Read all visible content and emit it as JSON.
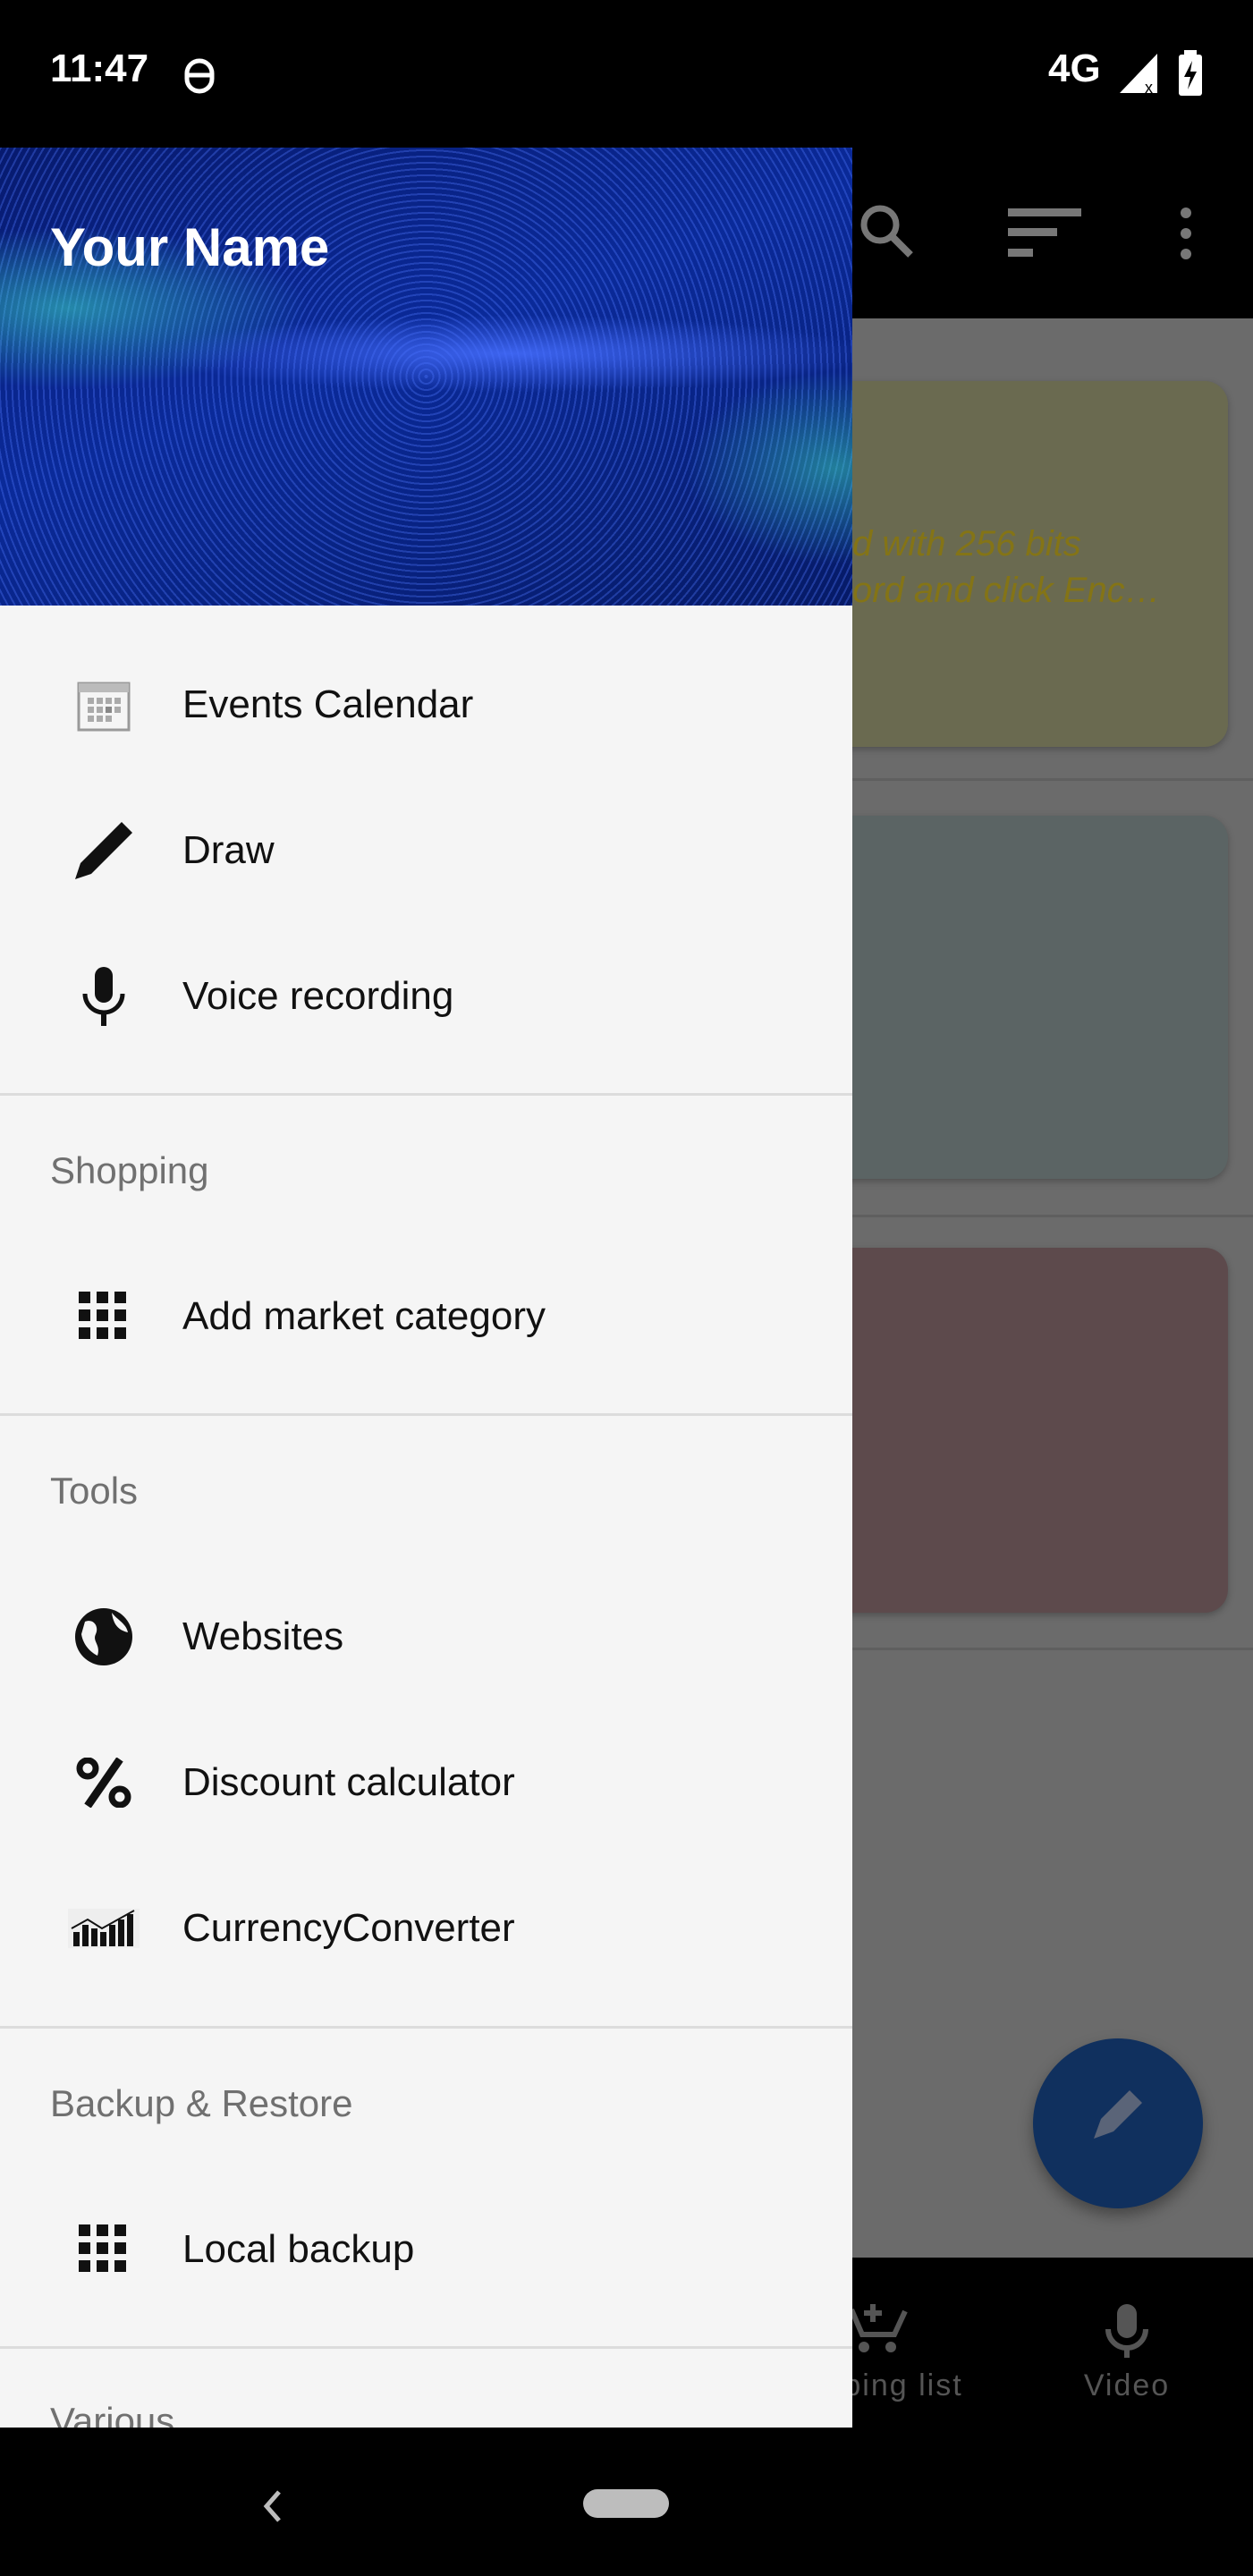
{
  "status_bar": {
    "time": "11:47",
    "network": "4G",
    "icons": [
      "android-debug-icon",
      "signal-icon",
      "battery-charging-icon"
    ]
  },
  "drawer": {
    "user_name": "Your Name",
    "groups": [
      {
        "header": "",
        "items": [
          {
            "label": "Events Calendar",
            "icon": "calendar-icon"
          },
          {
            "label": "Draw",
            "icon": "pencil-icon"
          },
          {
            "label": "Voice recording",
            "icon": "microphone-icon"
          }
        ]
      },
      {
        "header": "Shopping",
        "items": [
          {
            "label": "Add market category",
            "icon": "grid-icon"
          }
        ]
      },
      {
        "header": "Tools",
        "items": [
          {
            "label": "Websites",
            "icon": "globe-icon"
          },
          {
            "label": "Discount calculator",
            "icon": "percent-icon"
          },
          {
            "label": "CurrencyConverter",
            "icon": "chart-growth-icon"
          }
        ]
      },
      {
        "header": "Backup & Restore",
        "items": [
          {
            "label": "Local backup",
            "icon": "grid-icon"
          }
        ]
      },
      {
        "header": "Various",
        "items": []
      }
    ]
  },
  "background_app": {
    "toolbar_icons": [
      "search-icon",
      "sort-icon",
      "more-vert-icon"
    ],
    "notes": [
      {
        "color": "#6a6a50",
        "lines": [
          "d with 256 bits",
          "ord and click Enc…"
        ]
      },
      {
        "color": "#5b6464",
        "lines": []
      },
      {
        "color": "#5d4a4c",
        "lines": []
      }
    ],
    "fab_icon": "pencil-icon",
    "bottom_nav": [
      {
        "label": "ping list",
        "icon": "add-cart-icon"
      },
      {
        "label": "Video",
        "icon": "microphone-icon"
      }
    ]
  },
  "colors": {
    "drawer_bg": "#f5f5f5",
    "fab": "#10305e",
    "section_header": "#707070"
  }
}
